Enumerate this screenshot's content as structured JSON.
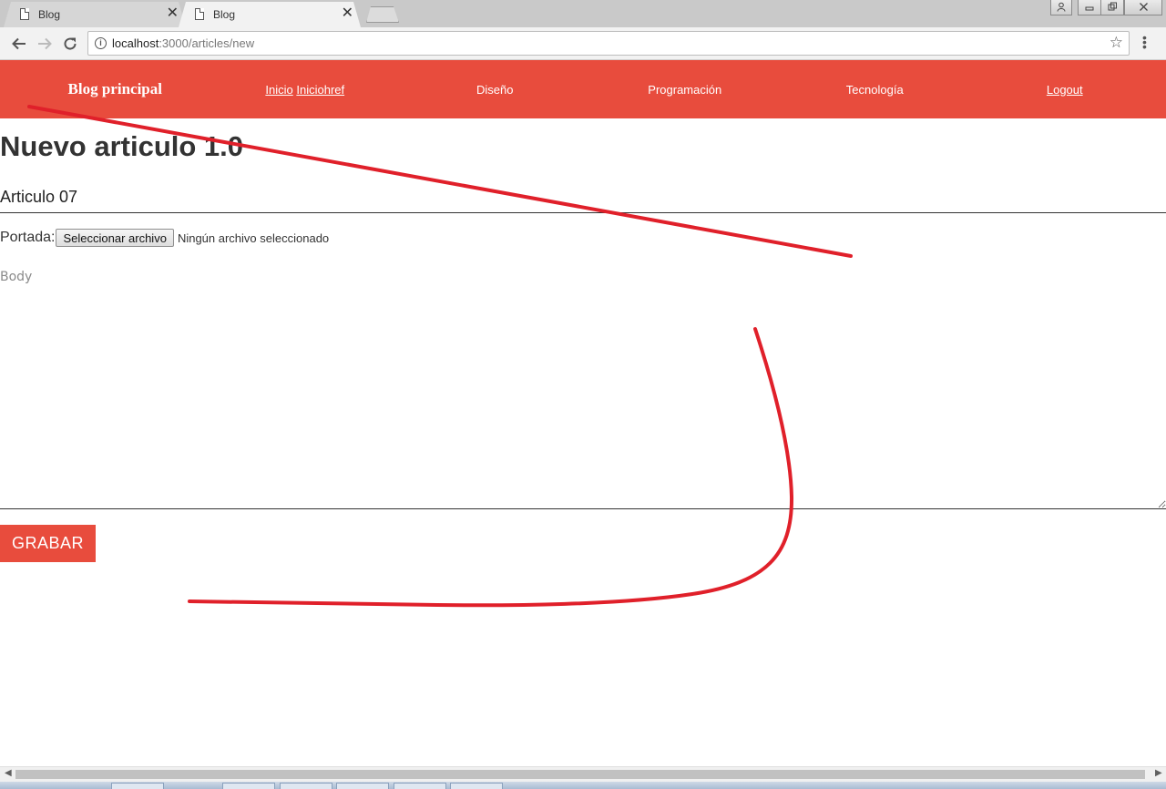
{
  "browser": {
    "tabs": [
      {
        "title": "Blog",
        "active": false
      },
      {
        "title": "Blog",
        "active": true
      }
    ],
    "tab_close_glyph": "✕",
    "url_host": "localhost",
    "url_path": ":3000/articles/new",
    "icons": {
      "back": "back-arrow-icon",
      "forward": "forward-arrow-icon",
      "reload": "reload-icon",
      "info": "info-icon",
      "star": "star-icon",
      "menu": "kebab-menu-icon",
      "profile": "person-icon",
      "minimize": "minimize-icon",
      "restore": "restore-icon",
      "close": "close-icon"
    }
  },
  "nav": {
    "brand": "Blog principal",
    "home_link_1": "Inicio",
    "home_link_2": "Iniciohref",
    "items": [
      "Diseño",
      "Programación",
      "Tecnología"
    ],
    "logout": "Logout"
  },
  "form": {
    "heading": "Nuevo articulo 1.0",
    "title_value": "Articulo 07",
    "cover_label": "Portada:",
    "file_button": "Seleccionar archivo",
    "file_status": "Ningún archivo seleccionado",
    "body_placeholder": "Body",
    "submit_label": "GRABAR"
  },
  "colors": {
    "nav_bg": "#e84c3d",
    "submit_bg": "#e84c3d",
    "annotation": "#e0202a"
  }
}
